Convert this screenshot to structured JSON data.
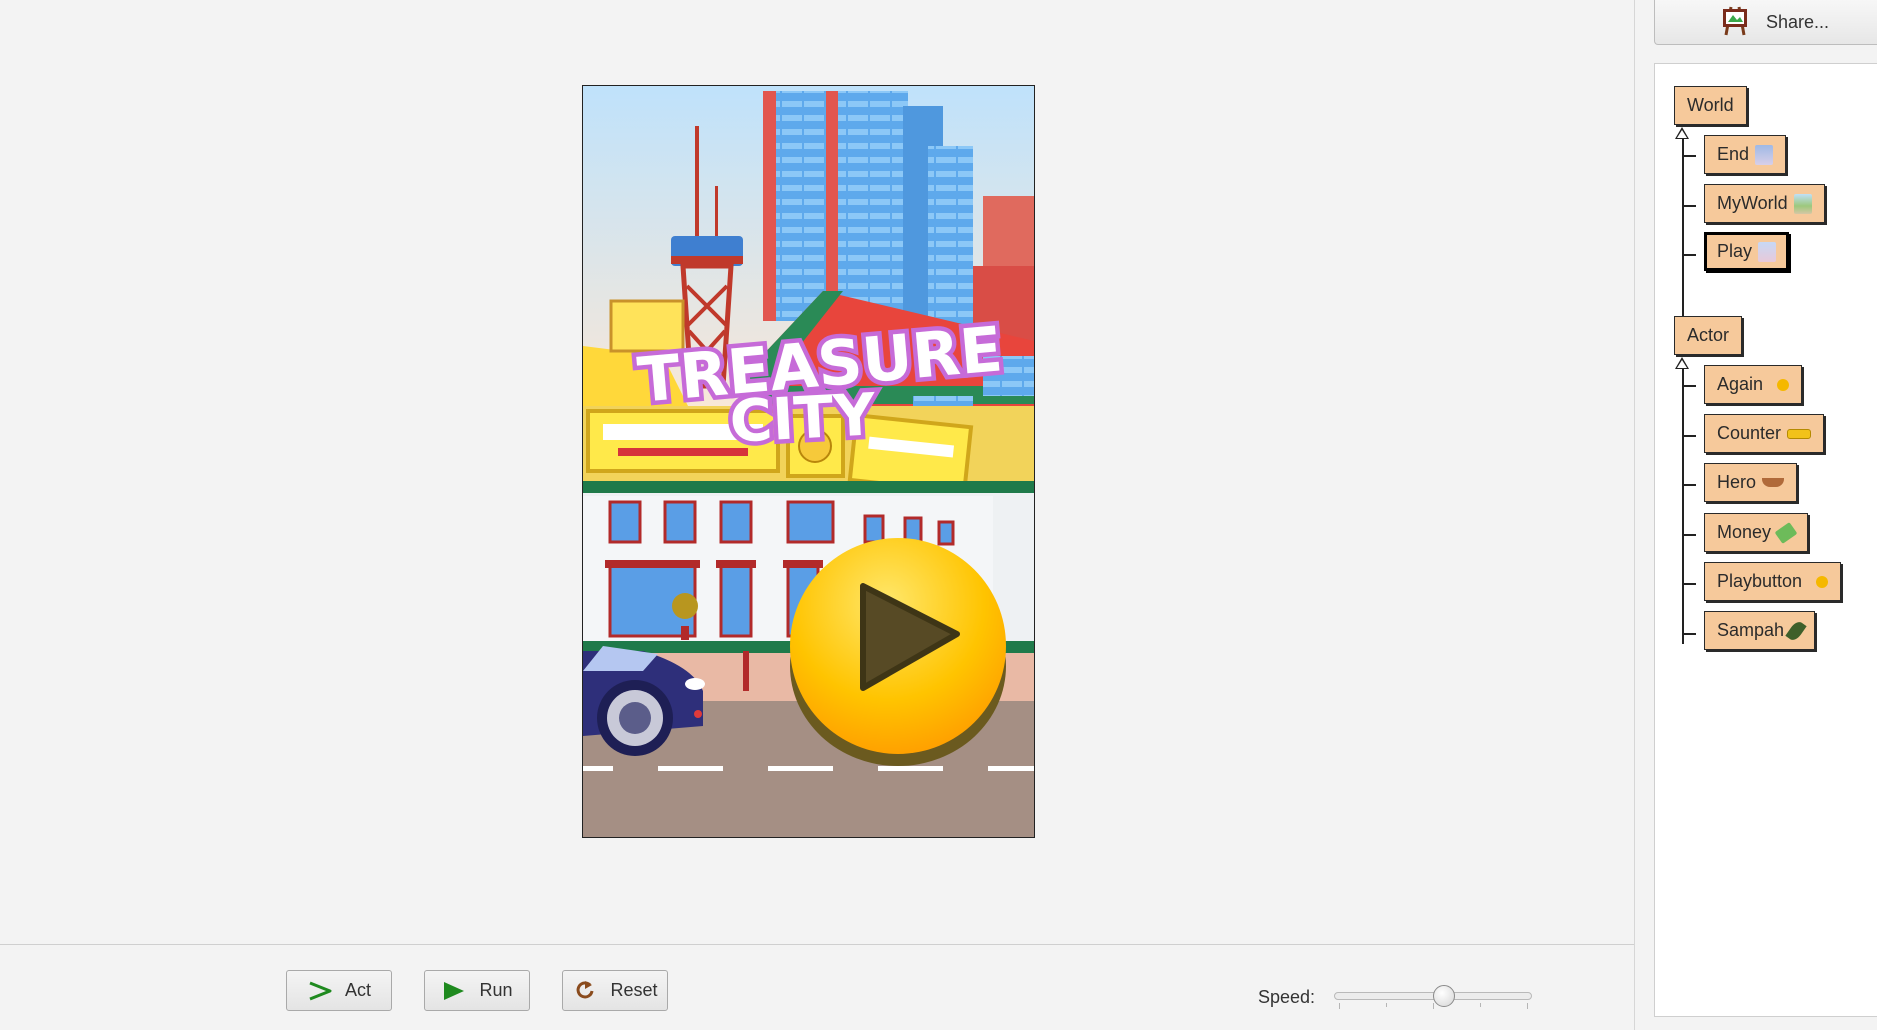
{
  "toolbar": {
    "share_label": "Share...",
    "act_label": "Act",
    "run_label": "Run",
    "reset_label": "Reset",
    "speed_label": "Speed:",
    "speed_value": 0.55
  },
  "game_scene": {
    "title_line1": "TREASURE",
    "title_line2": "CITY",
    "play_icon": "play-triangle-icon"
  },
  "class_tree": {
    "world": {
      "label": "World",
      "children": [
        {
          "label": "End",
          "icon": "end-image-icon",
          "selected": false
        },
        {
          "label": "MyWorld",
          "icon": "myworld-image-icon",
          "selected": false
        },
        {
          "label": "Play",
          "icon": "play-image-icon",
          "selected": true
        }
      ]
    },
    "actor": {
      "label": "Actor",
      "children": [
        {
          "label": "Again",
          "icon": "again-image-icon"
        },
        {
          "label": "Counter",
          "icon": "counter-image-icon"
        },
        {
          "label": "Hero",
          "icon": "hero-image-icon"
        },
        {
          "label": "Money",
          "icon": "money-image-icon"
        },
        {
          "label": "Playbutton",
          "icon": "playbutton-image-icon"
        },
        {
          "label": "Sampah",
          "icon": "sampah-image-icon"
        }
      ]
    }
  },
  "colors": {
    "class_box": "#f6c99b",
    "run_green": "#1f8a1f",
    "reset_brown": "#8a4b1d"
  }
}
